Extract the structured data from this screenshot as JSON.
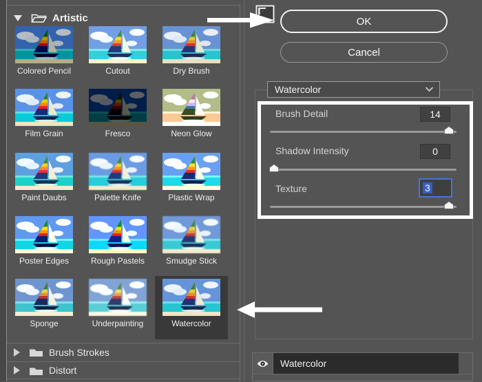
{
  "colors": {
    "background": "#545454",
    "selection_highlight": "#393939",
    "accent_blue": "#4277dd",
    "annotation_white": "#ffffff"
  },
  "left_panel": {
    "categories": [
      {
        "label": "Artistic",
        "expanded": true
      },
      {
        "label": "Brush Strokes",
        "expanded": false
      },
      {
        "label": "Distort",
        "expanded": false
      }
    ],
    "filters": [
      "Colored Pencil",
      "Cutout",
      "Dry Brush",
      "Film Grain",
      "Fresco",
      "Neon Glow",
      "Paint Daubs",
      "Palette Knife",
      "Plastic Wrap",
      "Poster Edges",
      "Rough Pastels",
      "Smudge Stick",
      "Sponge",
      "Underpainting",
      "Watercolor"
    ],
    "selected_filter": "Watercolor"
  },
  "right_panel": {
    "ok_label": "OK",
    "cancel_label": "Cancel",
    "filter_select": {
      "value": "Watercolor"
    },
    "sliders": [
      {
        "label": "Brush Detail",
        "value": "14",
        "position": 0.96
      },
      {
        "label": "Shadow Intensity",
        "value": "0",
        "position": 0.02
      },
      {
        "label": "Texture",
        "value": "3",
        "position": 0.96,
        "editing": true
      }
    ],
    "effect_layers": [
      {
        "name": "Watercolor",
        "visible": true
      }
    ]
  },
  "icons": {
    "disclosure-open": "triangle-down",
    "disclosure-closed": "triangle-right",
    "folder-open": "open-folder-outline",
    "folder-closed": "filled-folder",
    "chevron-down": "v-chevron",
    "eye": "visibility-eye",
    "collapse-panel": "bordered-square",
    "annotation-arrow-right": "white-right-arrow",
    "annotation-arrow-left": "white-left-arrow"
  }
}
